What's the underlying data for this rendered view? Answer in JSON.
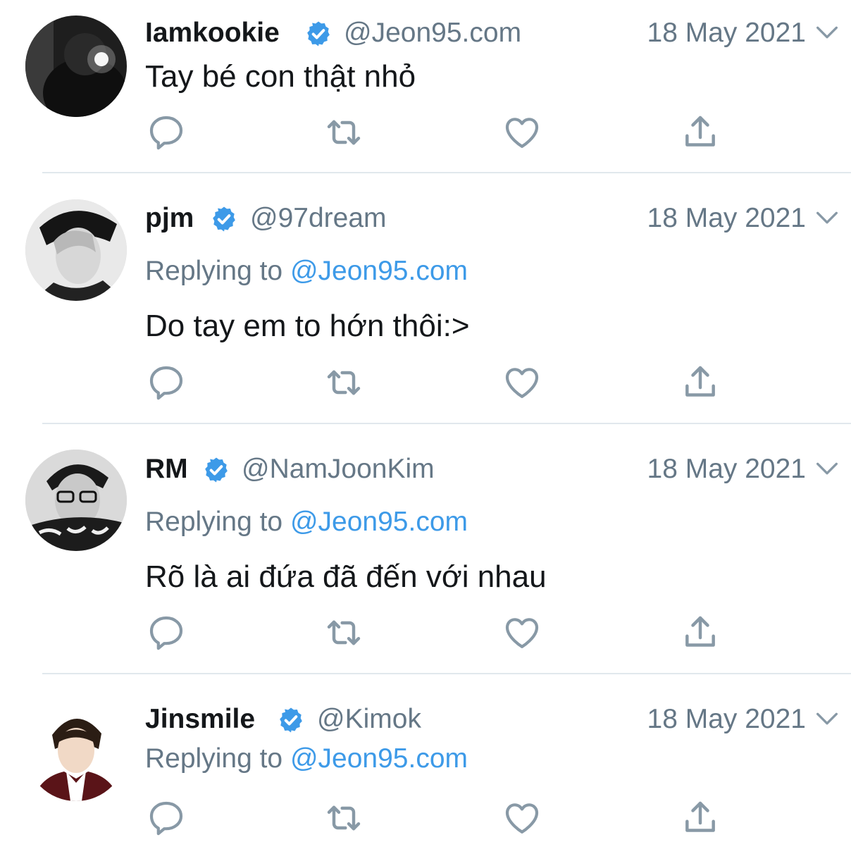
{
  "colors": {
    "accent": "#3d9ae8",
    "muted": "#657786",
    "text": "#14171a",
    "divider": "#e1e8ed",
    "icon": "#8899a6"
  },
  "tweets": [
    {
      "name": "Iamkookie",
      "handle": "@Jeon95.com",
      "date": "18 May 2021",
      "replying_prefix": "",
      "replying_to": "",
      "text": "Tay bé con thật nhỏ",
      "avatar": "avatar-photo-dark"
    },
    {
      "name": "pjm",
      "handle": "@97dream",
      "date": "18 May 2021",
      "replying_prefix": "Replying to ",
      "replying_to": "@Jeon95.com",
      "text": "Do tay em to hớn thôi:>",
      "avatar": "avatar-photo-bw"
    },
    {
      "name": "RM",
      "handle": "@NamJoonKim",
      "date": "18 May 2021",
      "replying_prefix": "Replying to ",
      "replying_to": "@Jeon95.com",
      "text": "Rõ là ai đứa đã đến với nhau",
      "avatar": "avatar-photo-bw-glasses"
    },
    {
      "name": "Jinsmile",
      "handle": "@Kimok",
      "date": "18 May 2021",
      "replying_prefix": "Replying to ",
      "replying_to": "@Jeon95.com",
      "text": "",
      "avatar": "avatar-photo-color"
    }
  ],
  "actions": [
    "reply-icon",
    "retweet-icon",
    "like-icon",
    "share-icon"
  ]
}
